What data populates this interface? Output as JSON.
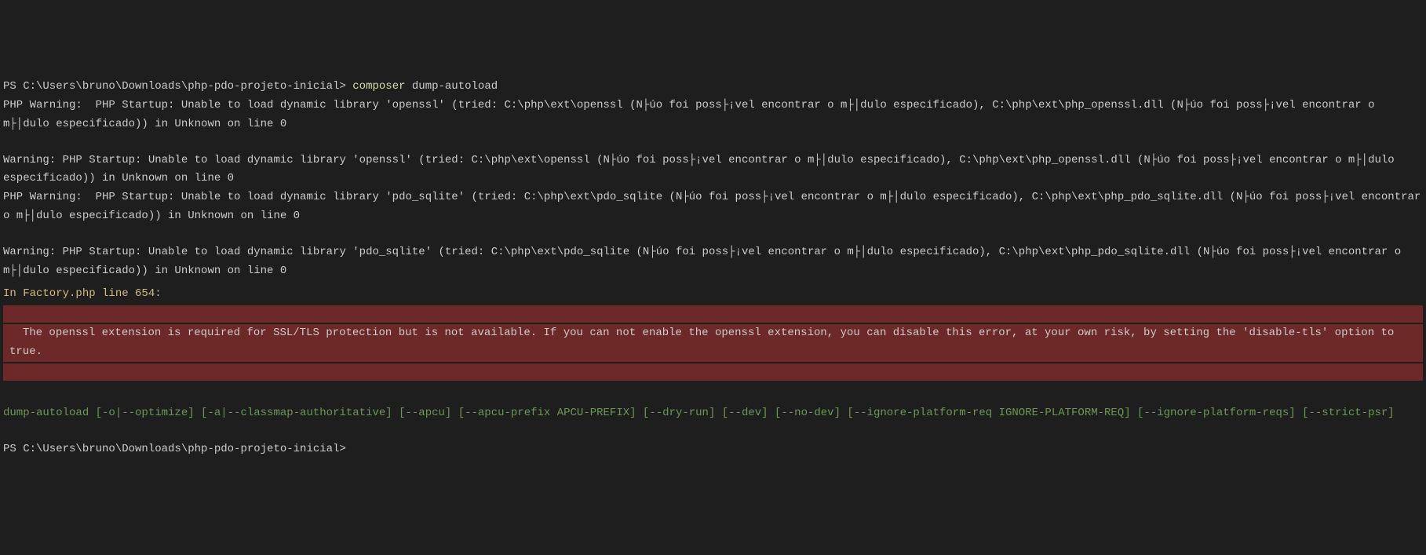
{
  "prompt1": {
    "path": "PS C:\\Users\\bruno\\Downloads\\php-pdo-projeto-inicial> ",
    "command": "composer",
    "args": " dump-autoload"
  },
  "warnings": {
    "w1": "PHP Warning:  PHP Startup: Unable to load dynamic library 'openssl' (tried: C:\\php\\ext\\openssl (N├úo foi poss├¡vel encontrar o m├│dulo especificado), C:\\php\\ext\\php_openssl.dll (N├úo foi poss├¡vel encontrar o m├│dulo especificado)) in Unknown on line 0",
    "w2": "Warning: PHP Startup: Unable to load dynamic library 'openssl' (tried: C:\\php\\ext\\openssl (N├úo foi poss├¡vel encontrar o m├│dulo especificado), C:\\php\\ext\\php_openssl.dll (N├úo foi poss├¡vel encontrar o m├│dulo especificado)) in Unknown on line 0",
    "w3": "PHP Warning:  PHP Startup: Unable to load dynamic library 'pdo_sqlite' (tried: C:\\php\\ext\\pdo_sqlite (N├úo foi poss├¡vel encontrar o m├│dulo especificado), C:\\php\\ext\\php_pdo_sqlite.dll (N├úo foi poss├¡vel encontrar o m├│dulo especificado)) in Unknown on line 0",
    "w4": "Warning: PHP Startup: Unable to load dynamic library 'pdo_sqlite' (tried: C:\\php\\ext\\pdo_sqlite (N├úo foi poss├¡vel encontrar o m├│dulo especificado), C:\\php\\ext\\php_pdo_sqlite.dll (N├úo foi poss├¡vel encontrar o m├│dulo especificado)) in Unknown on line 0"
  },
  "factory": "In Factory.php line 654:",
  "error": "  The openssl extension is required for SSL/TLS protection but is not available. If you can not enable the openssl extension, you can disable this error, at your own risk, by setting the 'disable-tls' option to true.",
  "usage": "dump-autoload [-o|--optimize] [-a|--classmap-authoritative] [--apcu] [--apcu-prefix APCU-PREFIX] [--dry-run] [--dev] [--no-dev] [--ignore-platform-req IGNORE-PLATFORM-REQ] [--ignore-platform-reqs] [--strict-psr]",
  "prompt2": {
    "path": "PS C:\\Users\\bruno\\Downloads\\php-pdo-projeto-inicial>"
  }
}
